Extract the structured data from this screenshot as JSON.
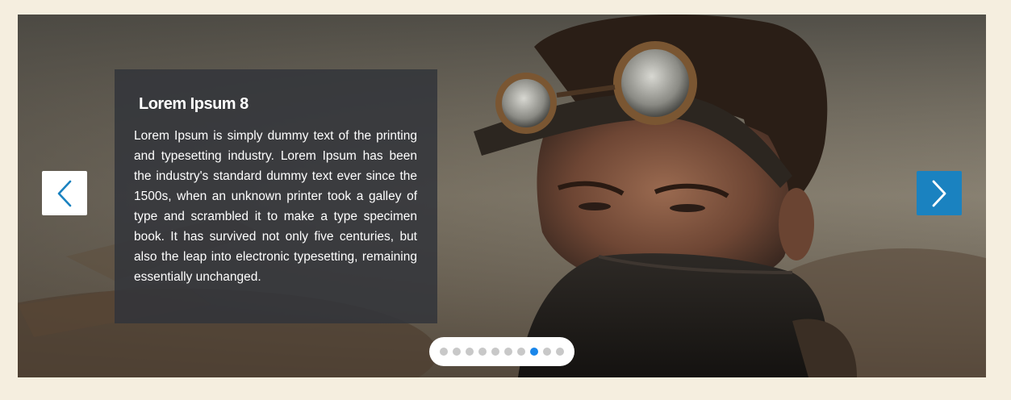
{
  "slider": {
    "caption": {
      "title": "Lorem Ipsum 8",
      "body": "Lorem Ipsum is simply dummy text of the printing and typesetting industry. Lorem Ipsum has been the industry's standard dummy text ever since the 1500s, when an unknown printer took a galley of type and scrambled it to make a type specimen book. It has survived not only five centuries, but also the leap into electronic typesetting, remaining essentially unchanged."
    },
    "prev_icon": "chevron-left-icon",
    "next_icon": "chevron-right-icon",
    "pager": {
      "total": 10,
      "active_index": 7
    },
    "image": "man-with-goggles-photo"
  },
  "colors": {
    "page_background": "#f5eedf",
    "accent": "#1a82c0",
    "active_dot": "#1a86ea",
    "inactive_dot": "#c8c8c8",
    "caption_background": "#32343a"
  }
}
